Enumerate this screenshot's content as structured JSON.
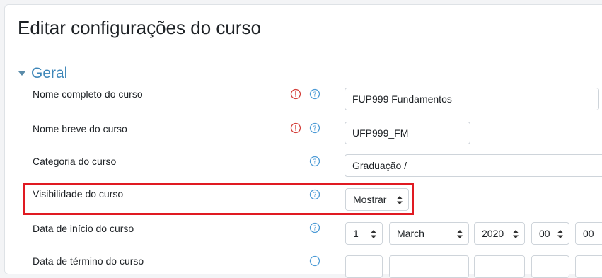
{
  "page": {
    "title": "Editar configurações do curso"
  },
  "section": {
    "title": "Geral"
  },
  "fields": {
    "fullname": {
      "label": "Nome completo do curso",
      "value": "FUP999 Fundamentos"
    },
    "shortname": {
      "label": "Nome breve do curso",
      "value": "UFP999_FM"
    },
    "category": {
      "label": "Categoria do curso",
      "value": "Graduação /"
    },
    "visibility": {
      "label": "Visibilidade do curso",
      "value": "Mostrar"
    },
    "startdate": {
      "label": "Data de início do curso",
      "day": "1",
      "month": "March",
      "year": "2020",
      "hour": "00",
      "minute": "00"
    },
    "enddate": {
      "label": "Data de término do curso"
    }
  },
  "colors": {
    "accent": "#3d86b8",
    "required": "#d43f3a",
    "help": "#4d9bd6",
    "highlight": "#e01a22"
  },
  "icons": {
    "required": "exclamation-circle-icon",
    "help": "question-circle-icon",
    "section": "caret-down-icon",
    "select": "updown-arrows-icon"
  }
}
